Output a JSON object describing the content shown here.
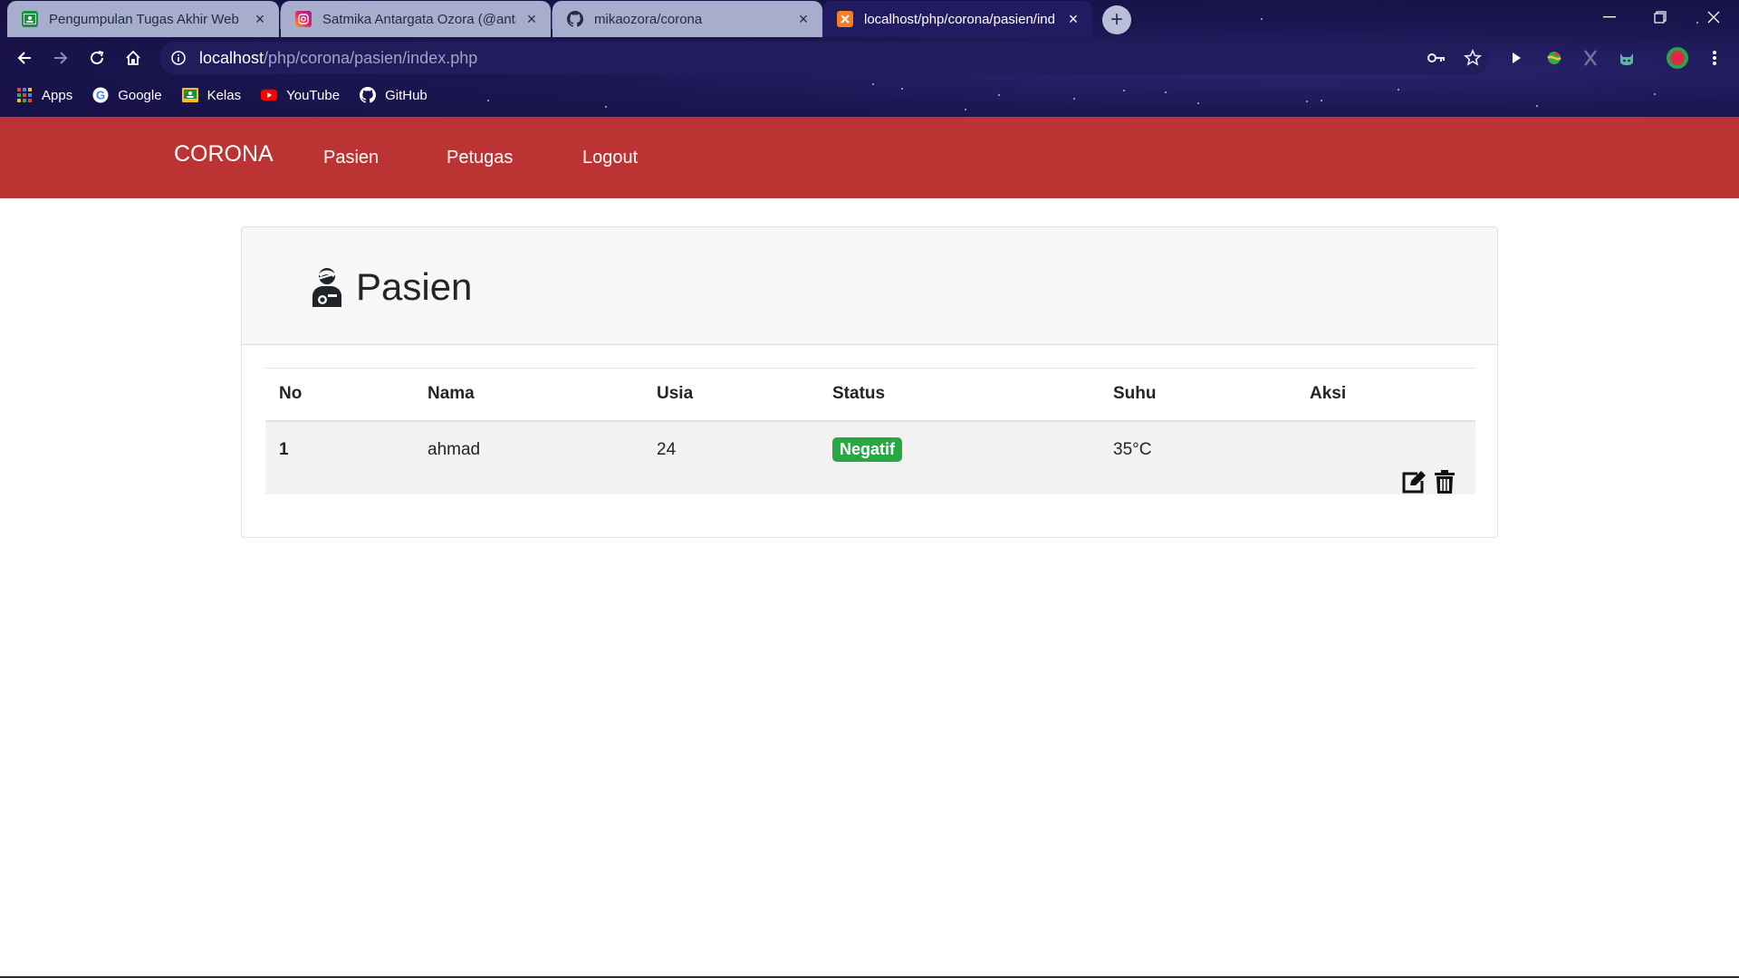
{
  "browser": {
    "tabs": [
      {
        "title": "Pengumpulan Tugas Akhir Web",
        "icon": "google-classroom-icon",
        "active": false
      },
      {
        "title": "Satmika Antargata Ozora (@anta",
        "icon": "instagram-icon",
        "active": false
      },
      {
        "title": "mikaozora/corona",
        "icon": "github-icon",
        "active": false
      },
      {
        "title": "localhost/php/corona/pasien/ind",
        "icon": "xampp-icon",
        "active": true
      }
    ],
    "address": {
      "host": "localhost",
      "path": "/php/corona/pasien/index.php"
    },
    "bookmarks": [
      {
        "label": "Apps",
        "icon": "apps-grid-icon"
      },
      {
        "label": "Google",
        "icon": "google-icon"
      },
      {
        "label": "Kelas",
        "icon": "classroom-icon"
      },
      {
        "label": "YouTube",
        "icon": "youtube-icon"
      },
      {
        "label": "GitHub",
        "icon": "github-icon"
      }
    ]
  },
  "navbar": {
    "brand": "CORONA",
    "links": [
      "Pasien",
      "Petugas",
      "Logout"
    ],
    "color": "#bb3333"
  },
  "page": {
    "title": "Pasien",
    "title_icon": "user-injured-icon"
  },
  "table": {
    "columns": [
      "No",
      "Nama",
      "Usia",
      "Status",
      "Suhu",
      "Aksi"
    ],
    "rows": [
      {
        "no": "1",
        "nama": "ahmad",
        "usia": "24",
        "status": "Negatif",
        "suhu": "35°C",
        "actions": [
          "edit-icon",
          "trash-icon"
        ]
      }
    ],
    "status_color": "#28a745"
  }
}
